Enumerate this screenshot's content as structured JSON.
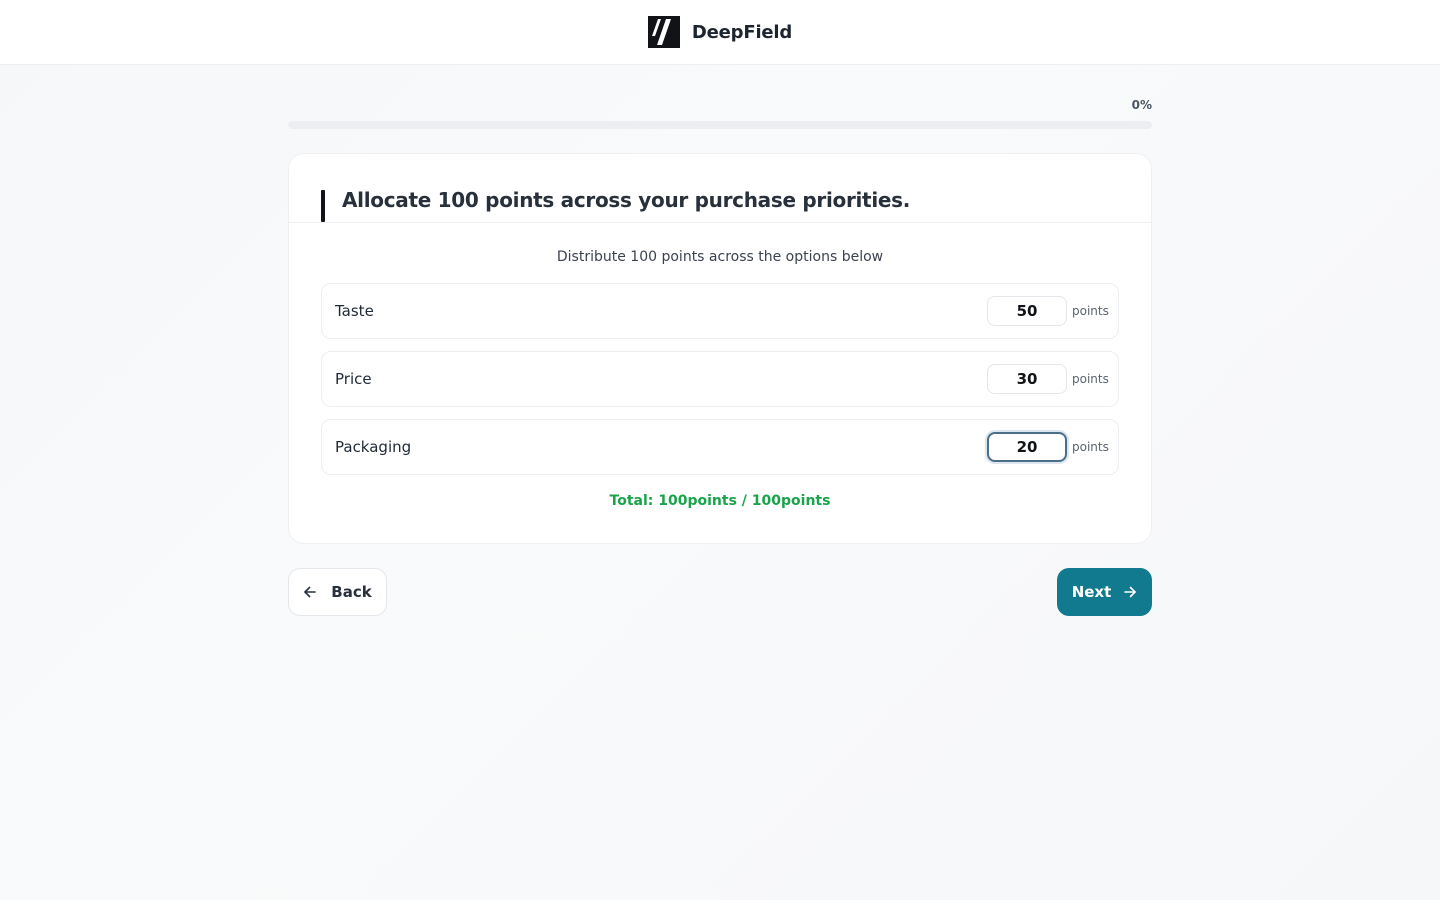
{
  "brand": {
    "name": "DeepField",
    "logo_icon": "deepfield-logo-icon"
  },
  "progress": {
    "label": "0%",
    "value_percent": 0
  },
  "question": {
    "title": "Allocate 100 points across your purchase priorities."
  },
  "instruction": "Distribute 100 points across the options below",
  "options": [
    {
      "label": "Taste",
      "value": "50",
      "unit": "points"
    },
    {
      "label": "Price",
      "value": "30",
      "unit": "points"
    },
    {
      "label": "Packaging",
      "value": "20",
      "unit": "points"
    }
  ],
  "total": "Total: 100points / 100points",
  "nav": {
    "back_label": "Back",
    "back_icon": "arrow-left-icon",
    "next_label": "Next",
    "next_icon": "arrow-right-icon"
  },
  "colors": {
    "accent": "#127a8f",
    "success": "#1aa34a",
    "dark": "#111317"
  }
}
